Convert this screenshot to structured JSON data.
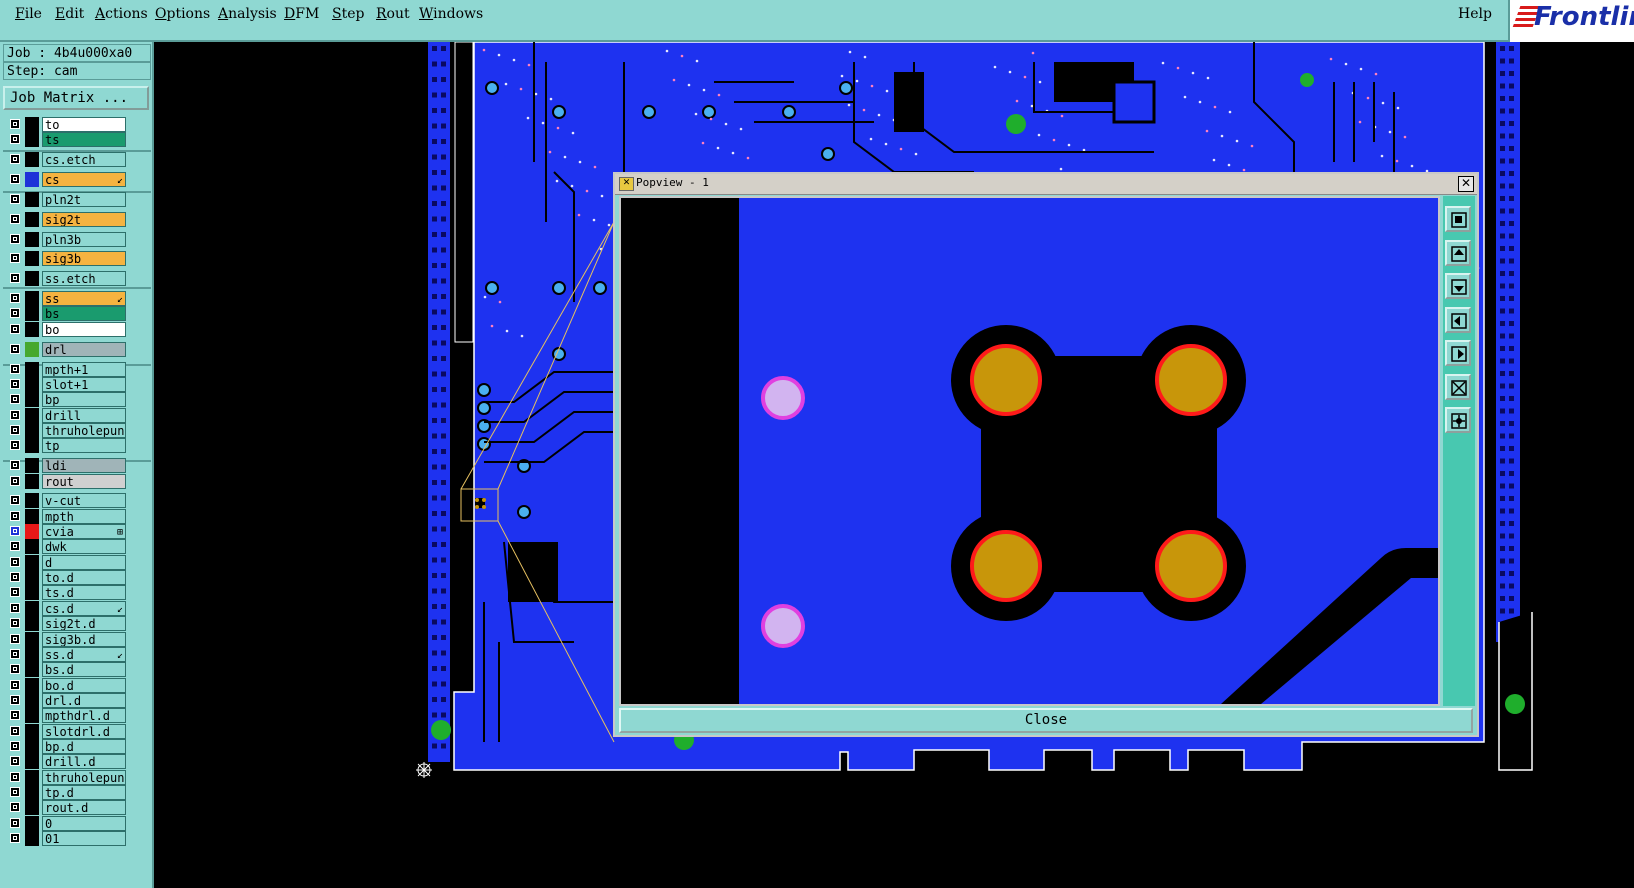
{
  "menubar": {
    "items": [
      "File",
      "Edit",
      "Actions",
      "Options",
      "Analysis",
      "DFM",
      "Step",
      "Rout",
      "Windows"
    ],
    "help": "Help",
    "brand": "Frontline"
  },
  "leftpanel": {
    "job": "Job : 4b4u000xa0",
    "step": "Step: cam",
    "job_matrix": "Job Matrix ..."
  },
  "layers": [
    {
      "name": "to",
      "bg": "#ffffff",
      "swatch": "#000000",
      "mark": ""
    },
    {
      "name": "ts",
      "bg": "#1a9b6e",
      "swatch": "#000000",
      "mark": ""
    },
    {
      "name": "cs.etch",
      "bg": "#8fd8d2",
      "swatch": "#000000",
      "mark": ""
    },
    {
      "name": "cs",
      "bg": "#f5b340",
      "swatch": "#1e32d8",
      "mark": "↙"
    },
    {
      "name": "pln2t",
      "bg": "#8fd8d2",
      "swatch": "#000000",
      "mark": ""
    },
    {
      "name": "sig2t",
      "bg": "#f5b340",
      "swatch": "#000000",
      "mark": ""
    },
    {
      "name": "pln3b",
      "bg": "#8fd8d2",
      "swatch": "#000000",
      "mark": ""
    },
    {
      "name": "sig3b",
      "bg": "#f5b340",
      "swatch": "#000000",
      "mark": ""
    },
    {
      "name": "ss.etch",
      "bg": "#8fd8d2",
      "swatch": "#000000",
      "mark": ""
    },
    {
      "name": "ss",
      "bg": "#f5b340",
      "swatch": "#000000",
      "mark": "↙"
    },
    {
      "name": "bs",
      "bg": "#1a9b6e",
      "swatch": "#000000",
      "mark": ""
    },
    {
      "name": "bo",
      "bg": "#ffffff",
      "swatch": "#000000",
      "mark": ""
    },
    {
      "name": "drl",
      "bg": "#a0b4b8",
      "swatch": "#46a82e",
      "mark": ""
    },
    {
      "name": "mpth+1",
      "bg": "#8fd8d2",
      "swatch": "#000000",
      "mark": ""
    },
    {
      "name": "slot+1",
      "bg": "#8fd8d2",
      "swatch": "#000000",
      "mark": ""
    },
    {
      "name": "bp",
      "bg": "#8fd8d2",
      "swatch": "#000000",
      "mark": ""
    },
    {
      "name": "drill",
      "bg": "#8fd8d2",
      "swatch": "#000000",
      "mark": ""
    },
    {
      "name": "thruholepunch",
      "bg": "#8fd8d2",
      "swatch": "#000000",
      "mark": ""
    },
    {
      "name": "tp",
      "bg": "#8fd8d2",
      "swatch": "#000000",
      "mark": ""
    },
    {
      "name": "ldi",
      "bg": "#a0b4b8",
      "swatch": "#000000",
      "mark": ""
    },
    {
      "name": "rout",
      "bg": "#d0d0d0",
      "swatch": "#000000",
      "mark": ""
    },
    {
      "name": "v-cut",
      "bg": "#8fd8d2",
      "swatch": "#000000",
      "mark": ""
    },
    {
      "name": "mpth",
      "bg": "#8fd8d2",
      "swatch": "#000000",
      "mark": ""
    },
    {
      "name": "cvia",
      "bg": "#8fd8d2",
      "swatch": "#e81818",
      "mark": "⊞"
    },
    {
      "name": "dwk",
      "bg": "#8fd8d2",
      "swatch": "#000000",
      "mark": ""
    },
    {
      "name": "d",
      "bg": "#8fd8d2",
      "swatch": "#000000",
      "mark": ""
    },
    {
      "name": "to.d",
      "bg": "#8fd8d2",
      "swatch": "#000000",
      "mark": ""
    },
    {
      "name": "ts.d",
      "bg": "#8fd8d2",
      "swatch": "#000000",
      "mark": ""
    },
    {
      "name": "cs.d",
      "bg": "#8fd8d2",
      "swatch": "#000000",
      "mark": "↙"
    },
    {
      "name": "sig2t.d",
      "bg": "#8fd8d2",
      "swatch": "#000000",
      "mark": ""
    },
    {
      "name": "sig3b.d",
      "bg": "#8fd8d2",
      "swatch": "#000000",
      "mark": ""
    },
    {
      "name": "ss.d",
      "bg": "#8fd8d2",
      "swatch": "#000000",
      "mark": "↙"
    },
    {
      "name": "bs.d",
      "bg": "#8fd8d2",
      "swatch": "#000000",
      "mark": ""
    },
    {
      "name": "bo.d",
      "bg": "#8fd8d2",
      "swatch": "#000000",
      "mark": ""
    },
    {
      "name": "drl.d",
      "bg": "#8fd8d2",
      "swatch": "#000000",
      "mark": ""
    },
    {
      "name": "mpthdrl.d",
      "bg": "#8fd8d2",
      "swatch": "#000000",
      "mark": ""
    },
    {
      "name": "slotdrl.d",
      "bg": "#8fd8d2",
      "swatch": "#000000",
      "mark": ""
    },
    {
      "name": "bp.d",
      "bg": "#8fd8d2",
      "swatch": "#000000",
      "mark": ""
    },
    {
      "name": "drill.d",
      "bg": "#8fd8d2",
      "swatch": "#000000",
      "mark": ""
    },
    {
      "name": "thruholepunch",
      "bg": "#8fd8d2",
      "swatch": "#000000",
      "mark": ""
    },
    {
      "name": "tp.d",
      "bg": "#8fd8d2",
      "swatch": "#000000",
      "mark": ""
    },
    {
      "name": "rout.d",
      "bg": "#8fd8d2",
      "swatch": "#000000",
      "mark": ""
    },
    {
      "name": "0",
      "bg": "#8fd8d2",
      "swatch": "#000000",
      "mark": ""
    },
    {
      "name": "01",
      "bg": "#8fd8d2",
      "swatch": "#000000",
      "mark": ""
    }
  ],
  "popview": {
    "title": "Popview - 1",
    "close_label": "Close",
    "tools": [
      "zoom-window-icon",
      "pan-up-icon",
      "pan-down-icon",
      "pan-left-icon",
      "pan-right-icon",
      "zoom-fit-icon",
      "zoom-home-icon"
    ]
  },
  "colors": {
    "panel": "#8fd8d2",
    "board": "#1e32f0",
    "pad": "#c8960a",
    "pad_ring": "#ff1a1a",
    "via": "#d2b4f0",
    "via_ring": "#e040e0"
  }
}
